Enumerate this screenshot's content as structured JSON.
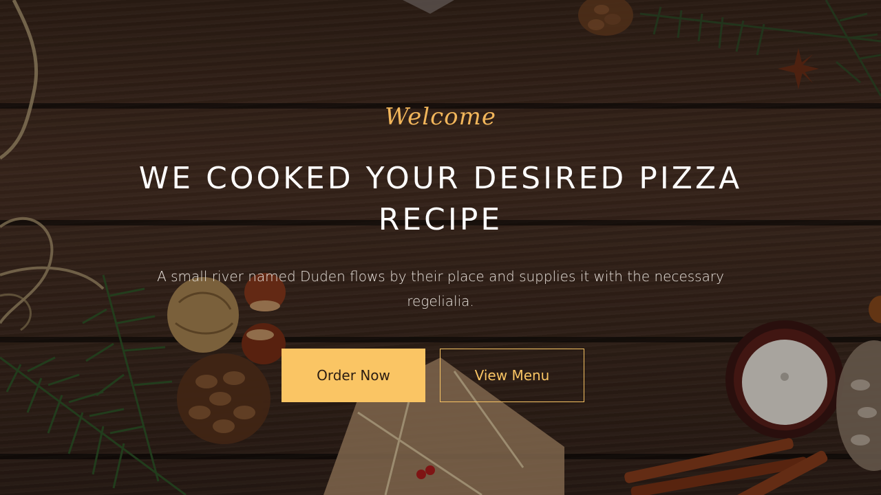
{
  "hero": {
    "welcome": "Welcome",
    "title": "WE COOKED YOUR DESIRED PIZZA RECIPE",
    "subtitle": "A small river named Duden flows by their place and supplies it with the necessary regelialia.",
    "buttons": {
      "order": "Order Now",
      "menu": "View Menu"
    }
  },
  "colors": {
    "accent": "#fac564",
    "background": "#3f2a1f",
    "title": "#ffffff"
  }
}
